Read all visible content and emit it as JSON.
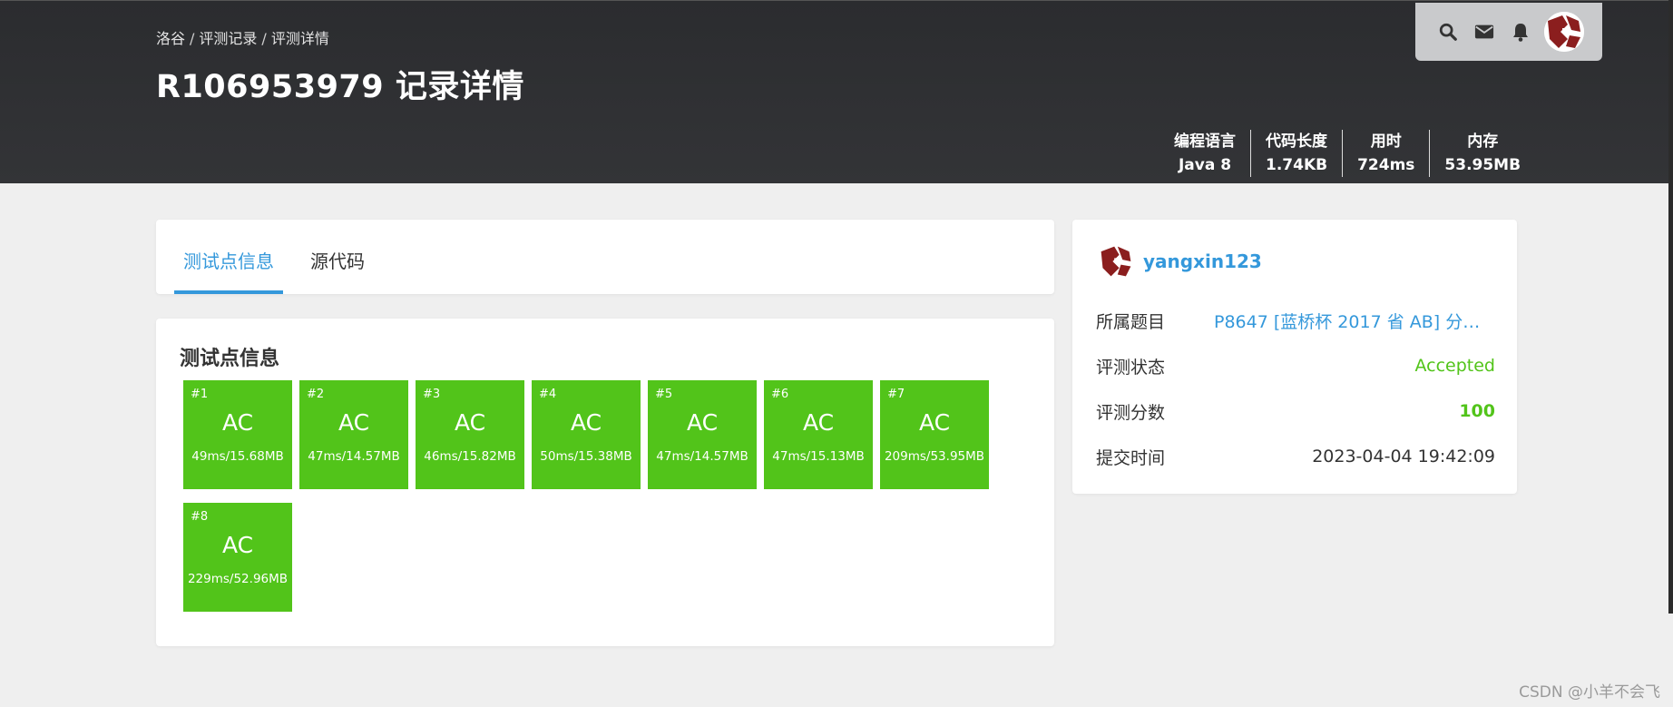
{
  "header": {
    "breadcrumb": [
      "洛谷",
      "评测记录",
      "评测详情"
    ],
    "breadcrumb_sep": "/",
    "title": "R106953979 记录详情",
    "stats": [
      {
        "key": "编程语言",
        "value": "Java 8"
      },
      {
        "key": "代码长度",
        "value": "1.74KB"
      },
      {
        "key": "用时",
        "value": "724ms"
      },
      {
        "key": "内存",
        "value": "53.95MB"
      }
    ],
    "icons": [
      "search-icon",
      "mail-icon",
      "bell-icon"
    ]
  },
  "tabs": [
    {
      "label": "测试点信息",
      "active": true
    },
    {
      "label": "源代码",
      "active": false
    }
  ],
  "testcases": {
    "title": "测试点信息",
    "items": [
      {
        "num": "#1",
        "status": "AC",
        "time_mem": "49ms/15.68MB"
      },
      {
        "num": "#2",
        "status": "AC",
        "time_mem": "47ms/14.57MB"
      },
      {
        "num": "#3",
        "status": "AC",
        "time_mem": "46ms/15.82MB"
      },
      {
        "num": "#4",
        "status": "AC",
        "time_mem": "50ms/15.38MB"
      },
      {
        "num": "#5",
        "status": "AC",
        "time_mem": "47ms/14.57MB"
      },
      {
        "num": "#6",
        "status": "AC",
        "time_mem": "47ms/15.13MB"
      },
      {
        "num": "#7",
        "status": "AC",
        "time_mem": "209ms/53.95MB"
      },
      {
        "num": "#8",
        "status": "AC",
        "time_mem": "229ms/52.96MB"
      }
    ]
  },
  "info": {
    "username": "yangxin123",
    "rows": [
      {
        "label": "所属题目",
        "value": "P8647 [蓝桥杯 2017 省 AB] 分巧..."
      },
      {
        "label": "评测状态",
        "value": "Accepted"
      },
      {
        "label": "评测分数",
        "value": "100"
      },
      {
        "label": "提交时间",
        "value": "2023-04-04 19:42:09"
      }
    ]
  },
  "watermark": "CSDN @小羊不会飞",
  "colors": {
    "accent": "#3498db",
    "ac_green": "#52c41a",
    "header_bg": "#2f3033"
  }
}
